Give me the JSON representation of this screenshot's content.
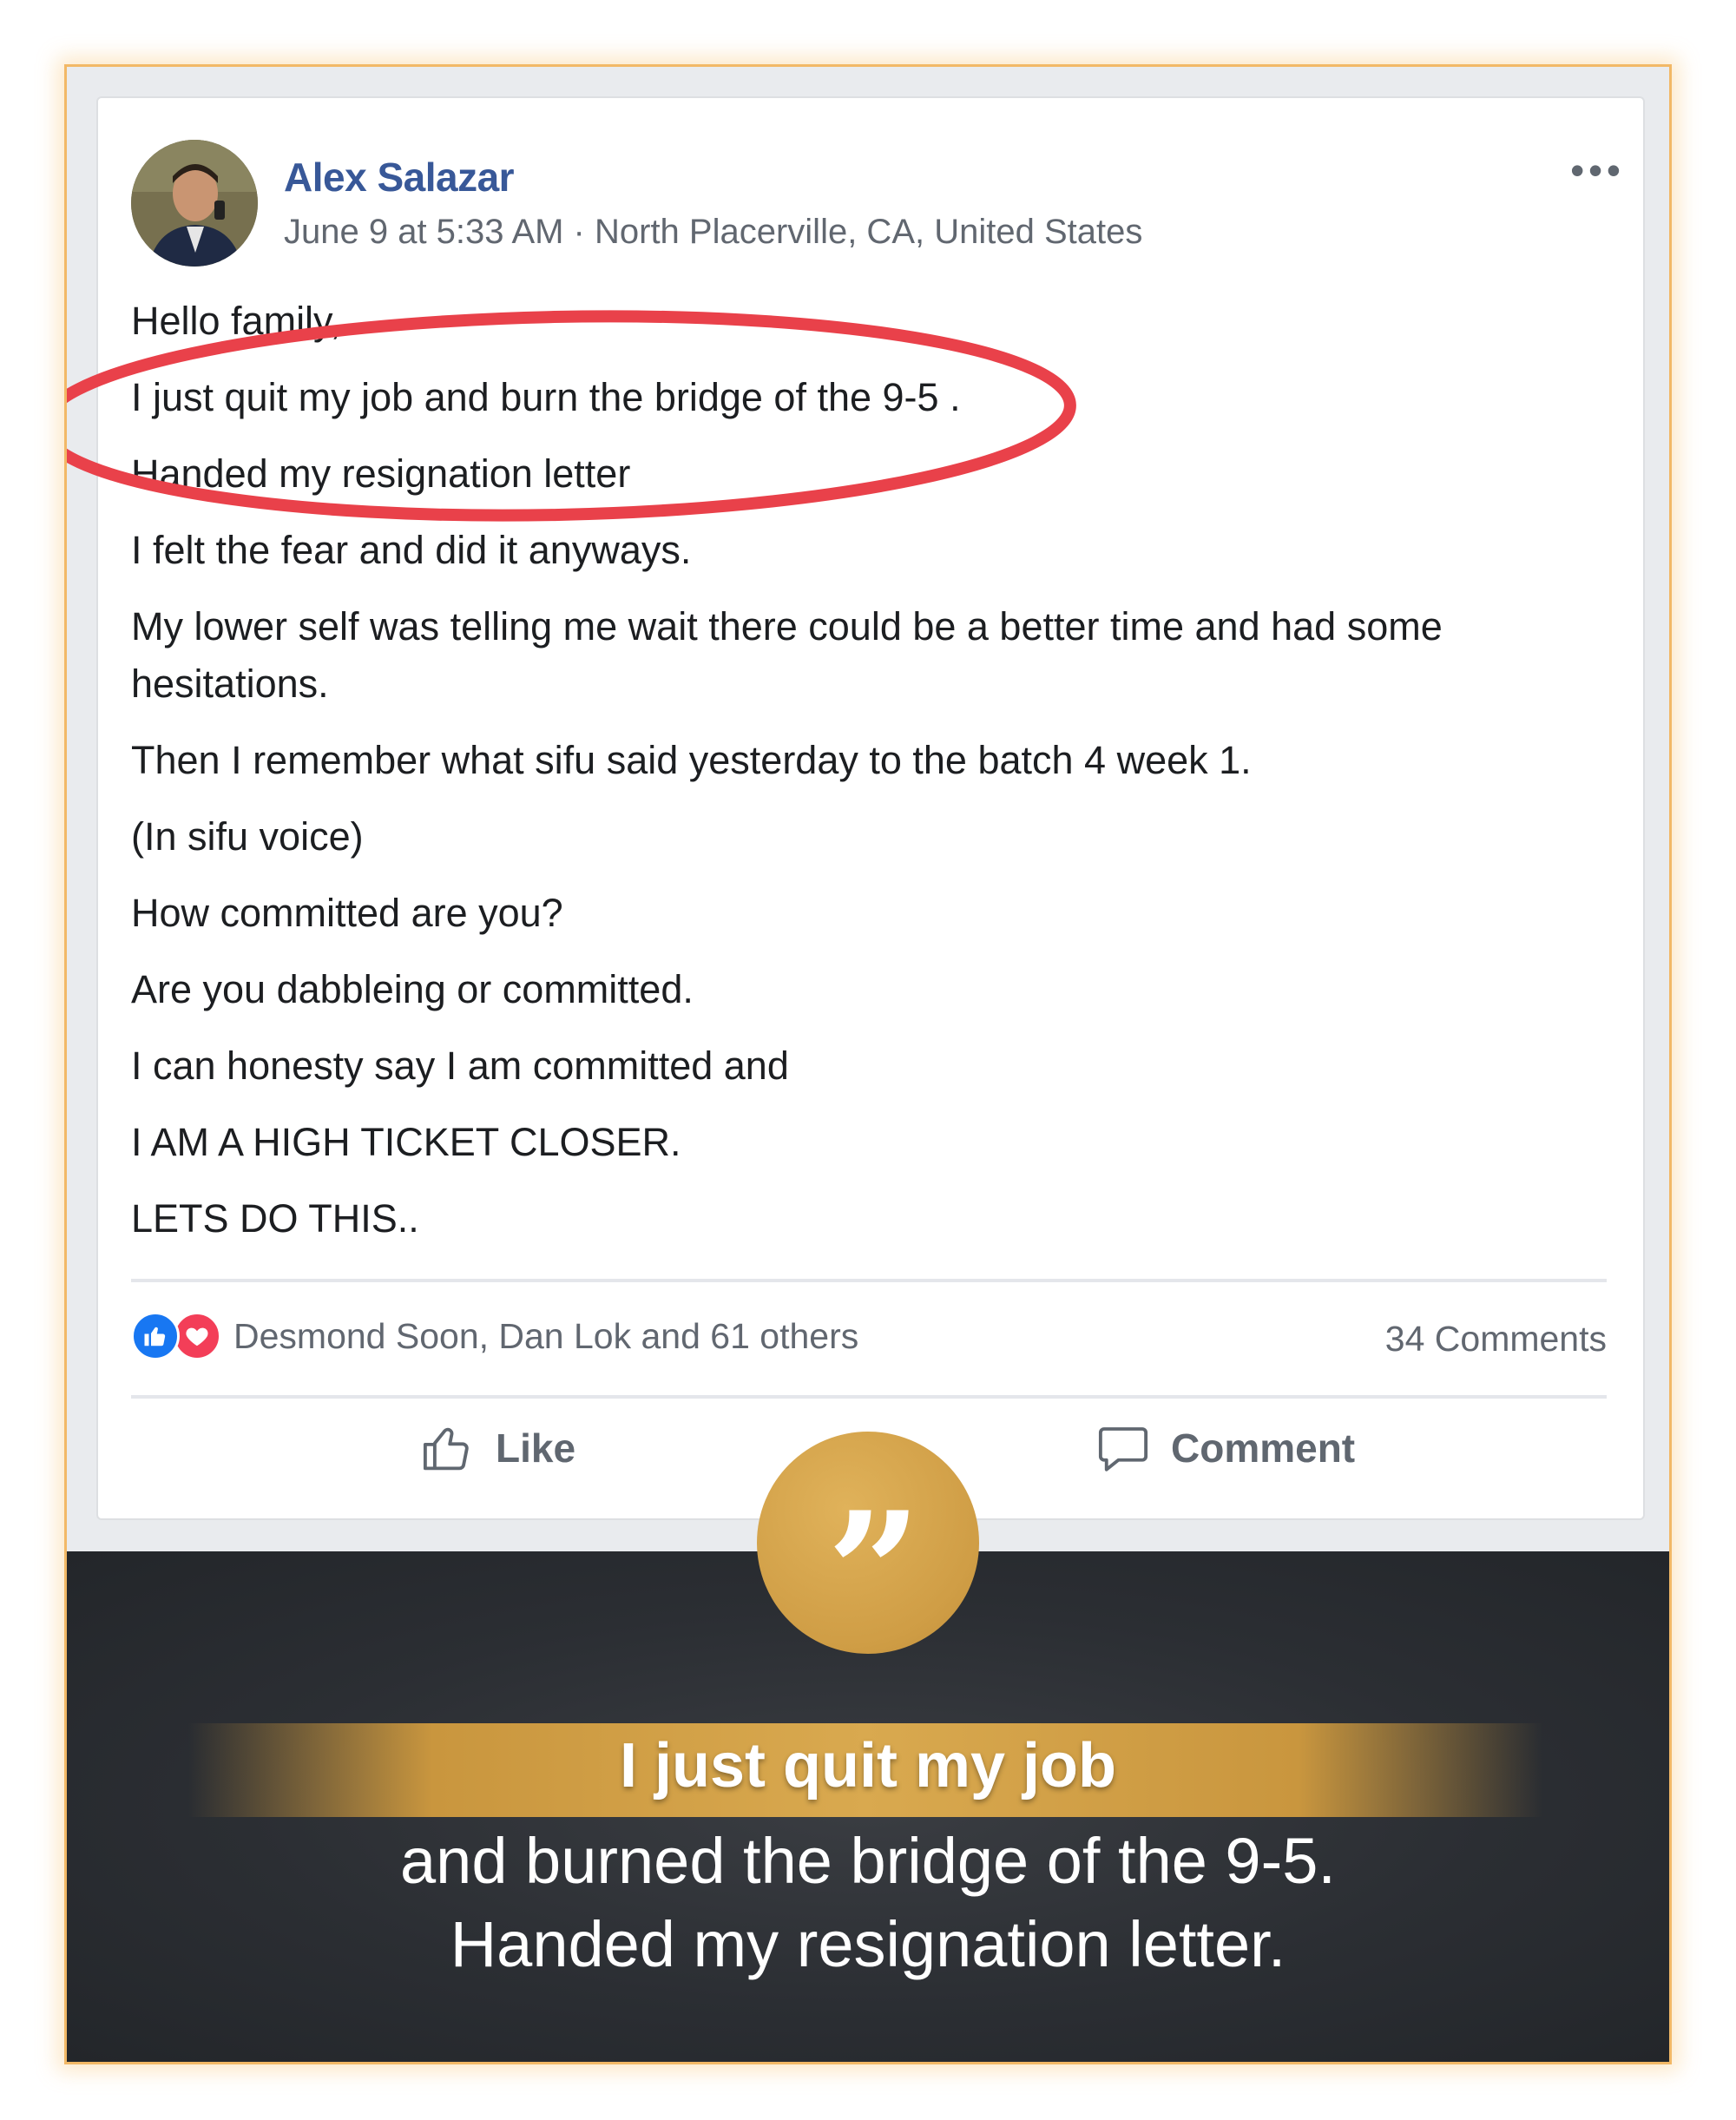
{
  "post": {
    "author": "Alex Salazar",
    "meta": "June 9 at 5:33 AM · North Placerville, CA, United States",
    "more_icon": "more-horizontal-icon",
    "lines": [
      "Hello family,",
      "I just quit my job and burn the bridge of the 9-5 .",
      "Handed my resignation letter",
      "I felt the fear and did it anyways.",
      "My lower self was telling me wait there could be a better time and had some hesitations.",
      "Then I remember what sifu said yesterday to the batch 4 week 1.",
      "(In sifu voice)",
      "How committed are you?",
      "Are you dabbleing or committed.",
      "I can honesty say I am committed and",
      "I AM A HIGH TICKET CLOSER.",
      "LETS DO THIS.."
    ],
    "reactions_text": "Desmond Soon, Dan Lok and 61 others",
    "comments_count": "34 Comments",
    "actions": {
      "like": "Like",
      "comment": "Comment"
    }
  },
  "quote_panel": {
    "headline": "I just quit my job",
    "line2": "and burned the bridge of the 9-5.",
    "line3": "Handed my resignation letter."
  },
  "colors": {
    "author": "#385898",
    "highlight_ellipse": "#e9414a",
    "gold": "#cf9d45",
    "frame_border": "#f2b866"
  }
}
